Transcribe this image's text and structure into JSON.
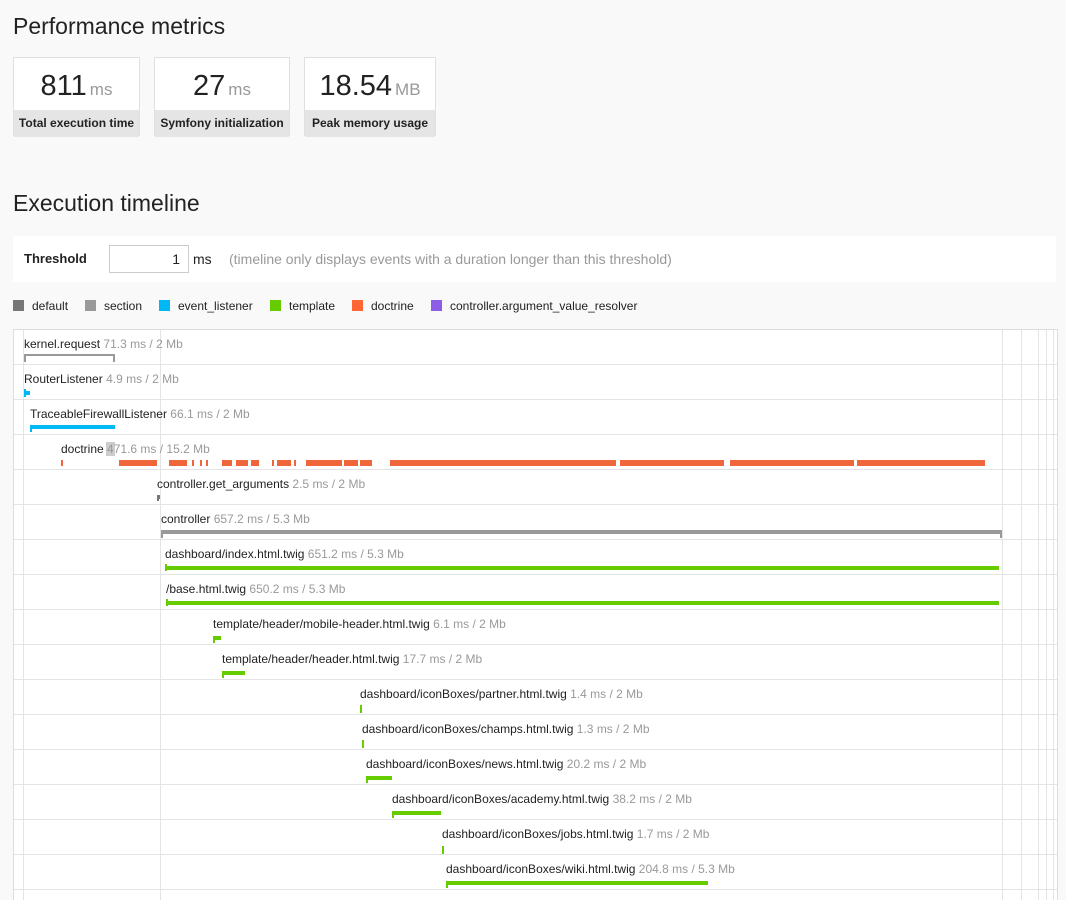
{
  "headings": {
    "performance": "Performance metrics",
    "timeline": "Execution timeline"
  },
  "metrics": [
    {
      "value": "811",
      "unit": "ms",
      "label": "Total execution time"
    },
    {
      "value": "27",
      "unit": "ms",
      "label": "Symfony initialization"
    },
    {
      "value": "18.54",
      "unit": "MB",
      "label": "Peak memory usage"
    }
  ],
  "threshold": {
    "label": "Threshold",
    "value": "1",
    "unit": "ms",
    "help": "(timeline only displays events with a duration longer than this threshold)"
  },
  "legend": [
    {
      "name": "default",
      "color": "#777777"
    },
    {
      "name": "section",
      "color": "#999999"
    },
    {
      "name": "event_listener",
      "color": "#00b8f5"
    },
    {
      "name": "template",
      "color": "#66cc00"
    },
    {
      "name": "doctrine",
      "color": "#ff6633"
    },
    {
      "name": "controller.argument_value_resolver",
      "color": "#8c5de6"
    }
  ],
  "events": [
    {
      "name": "kernel.request",
      "info": "71.3 ms / 2 Mb",
      "category": "section"
    },
    {
      "name": "RouterListener",
      "info": "4.9 ms / 2 Mb",
      "category": "event_listener"
    },
    {
      "name": "TraceableFirewallListener",
      "info": "66.1 ms / 2 Mb",
      "category": "event_listener"
    },
    {
      "name": "doctrine",
      "info": "471.6 ms / 15.2 Mb",
      "category": "doctrine"
    },
    {
      "name": "controller.get_arguments",
      "info": "2.5 ms / 2 Mb",
      "category": "default"
    },
    {
      "name": "controller",
      "info": "657.2 ms / 5.3 Mb",
      "category": "section"
    },
    {
      "name": "dashboard/index.html.twig",
      "info": "651.2 ms / 5.3 Mb",
      "category": "template"
    },
    {
      "name": "/base.html.twig",
      "info": "650.2 ms / 5.3 Mb",
      "category": "template"
    },
    {
      "name": "template/header/mobile-header.html.twig",
      "info": "6.1 ms / 2 Mb",
      "category": "template"
    },
    {
      "name": "template/header/header.html.twig",
      "info": "17.7 ms / 2 Mb",
      "category": "template"
    },
    {
      "name": "dashboard/iconBoxes/partner.html.twig",
      "info": "1.4 ms / 2 Mb",
      "category": "template"
    },
    {
      "name": "dashboard/iconBoxes/champs.html.twig",
      "info": "1.3 ms / 2 Mb",
      "category": "template"
    },
    {
      "name": "dashboard/iconBoxes/news.html.twig",
      "info": "20.2 ms / 2 Mb",
      "category": "template"
    },
    {
      "name": "dashboard/iconBoxes/academy.html.twig",
      "info": "38.2 ms / 2 Mb",
      "category": "template"
    },
    {
      "name": "dashboard/iconBoxes/jobs.html.twig",
      "info": "1.7 ms / 2 Mb",
      "category": "template"
    },
    {
      "name": "dashboard/iconBoxes/wiki.html.twig",
      "info": "204.8 ms / 5.3 Mb",
      "category": "template"
    }
  ]
}
